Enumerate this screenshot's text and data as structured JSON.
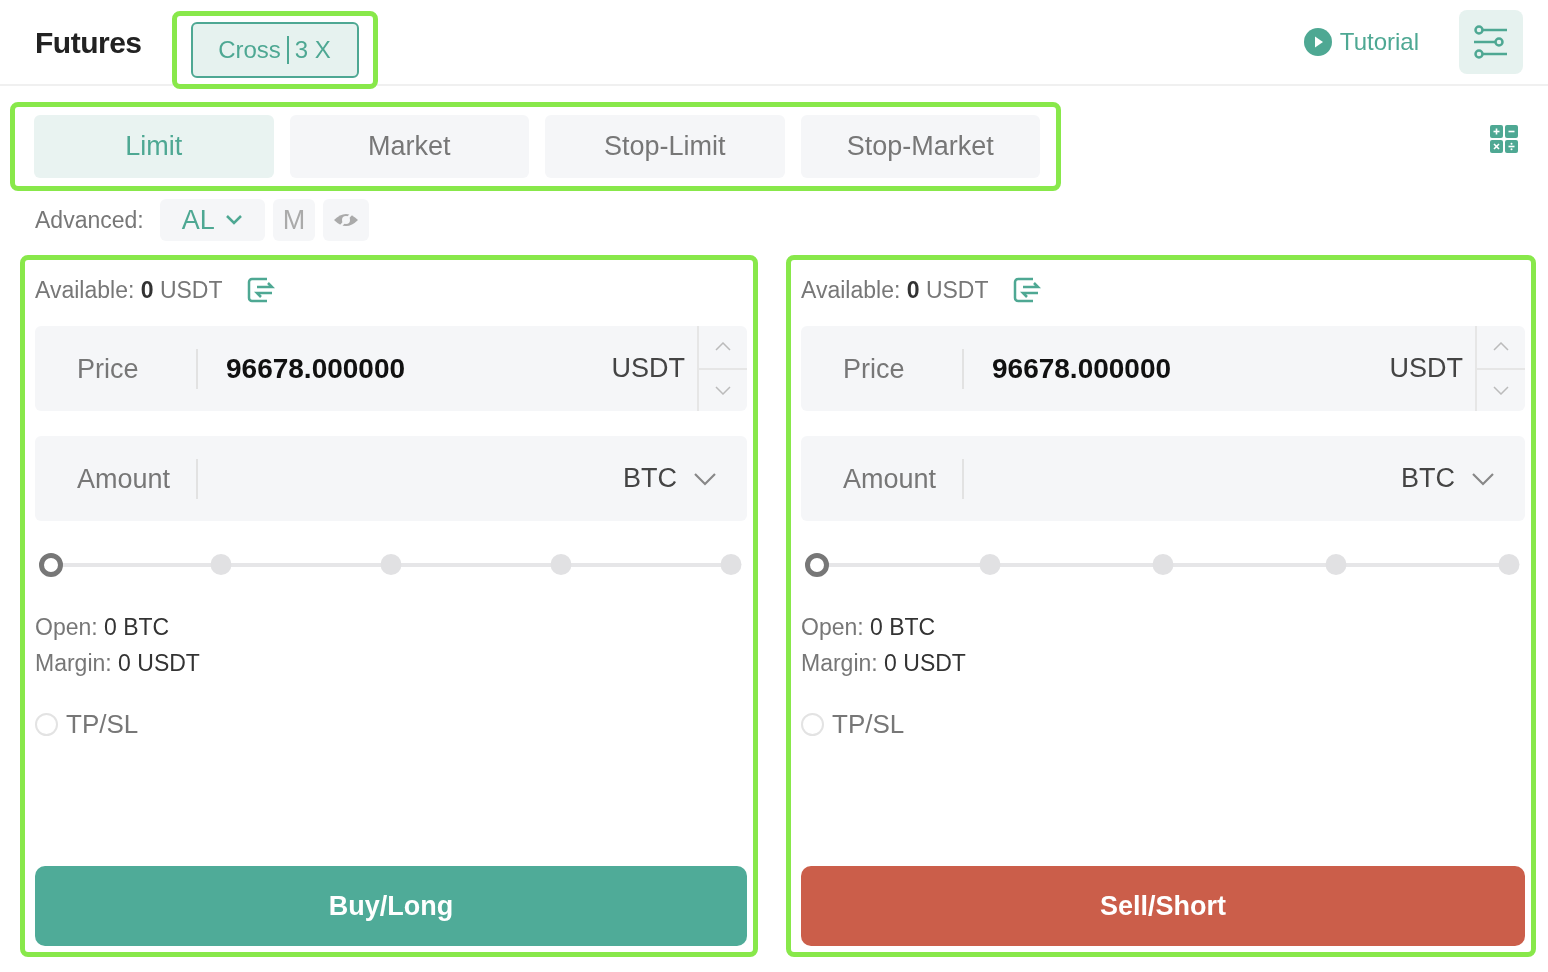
{
  "header": {
    "title": "Futures",
    "margin_mode": {
      "mode": "Cross",
      "leverage": "3 X"
    },
    "tutorial": "Tutorial"
  },
  "order_types": [
    {
      "label": "Limit",
      "selected": true
    },
    {
      "label": "Market",
      "selected": false
    },
    {
      "label": "Stop-Limit",
      "selected": false
    },
    {
      "label": "Stop-Market",
      "selected": false
    }
  ],
  "advanced": {
    "label": "Advanced:",
    "options": [
      {
        "kind": "dropdown",
        "label": "AL",
        "selected": true
      },
      {
        "kind": "text",
        "label": "M",
        "selected": false
      },
      {
        "kind": "icon",
        "selected": false
      }
    ]
  },
  "panels": [
    {
      "kind": "buy",
      "available": {
        "label": "Available:",
        "value": "0",
        "unit": "USDT"
      },
      "price": {
        "label": "Price",
        "value": "96678.000000",
        "unit": "USDT"
      },
      "amount": {
        "label": "Amount",
        "unit": "BTC"
      },
      "slider": {
        "level": 0
      },
      "open": {
        "label": "Open:",
        "value": "0",
        "unit": "BTC"
      },
      "margin": {
        "label": "Margin:",
        "value": "0",
        "unit": "USDT"
      },
      "tpsl": {
        "label": "TP/SL",
        "checked": false
      },
      "button": "Buy/Long"
    },
    {
      "kind": "sell",
      "available": {
        "label": "Available:",
        "value": "0",
        "unit": "USDT"
      },
      "price": {
        "label": "Price",
        "value": "96678.000000",
        "unit": "USDT"
      },
      "amount": {
        "label": "Amount",
        "unit": "BTC"
      },
      "slider": {
        "level": 0
      },
      "open": {
        "label": "Open:",
        "value": "0",
        "unit": "BTC"
      },
      "margin": {
        "label": "Margin:",
        "value": "0",
        "unit": "USDT"
      },
      "tpsl": {
        "label": "TP/SL",
        "checked": false
      },
      "button": "Sell/Short"
    }
  ]
}
